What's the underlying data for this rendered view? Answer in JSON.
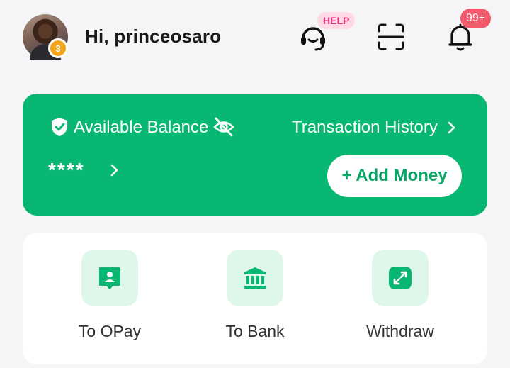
{
  "header": {
    "greeting": "Hi, princeosaro",
    "avatar_badge": "3",
    "help_badge": "HELP",
    "notification_badge": "99+"
  },
  "balance_card": {
    "label": "Available Balance",
    "history_link": "Transaction History",
    "balance_masked": "****",
    "add_money_label": "+ Add Money"
  },
  "actions": [
    {
      "label": "To OPay",
      "icon": "person-card-icon"
    },
    {
      "label": "To Bank",
      "icon": "bank-icon"
    },
    {
      "label": "Withdraw",
      "icon": "withdraw-arrows-icon"
    }
  ],
  "colors": {
    "brand_green": "#08b872",
    "tile_bg": "#dff7ea",
    "badge_red": "#f2596b",
    "help_pink": "#e8337a"
  }
}
